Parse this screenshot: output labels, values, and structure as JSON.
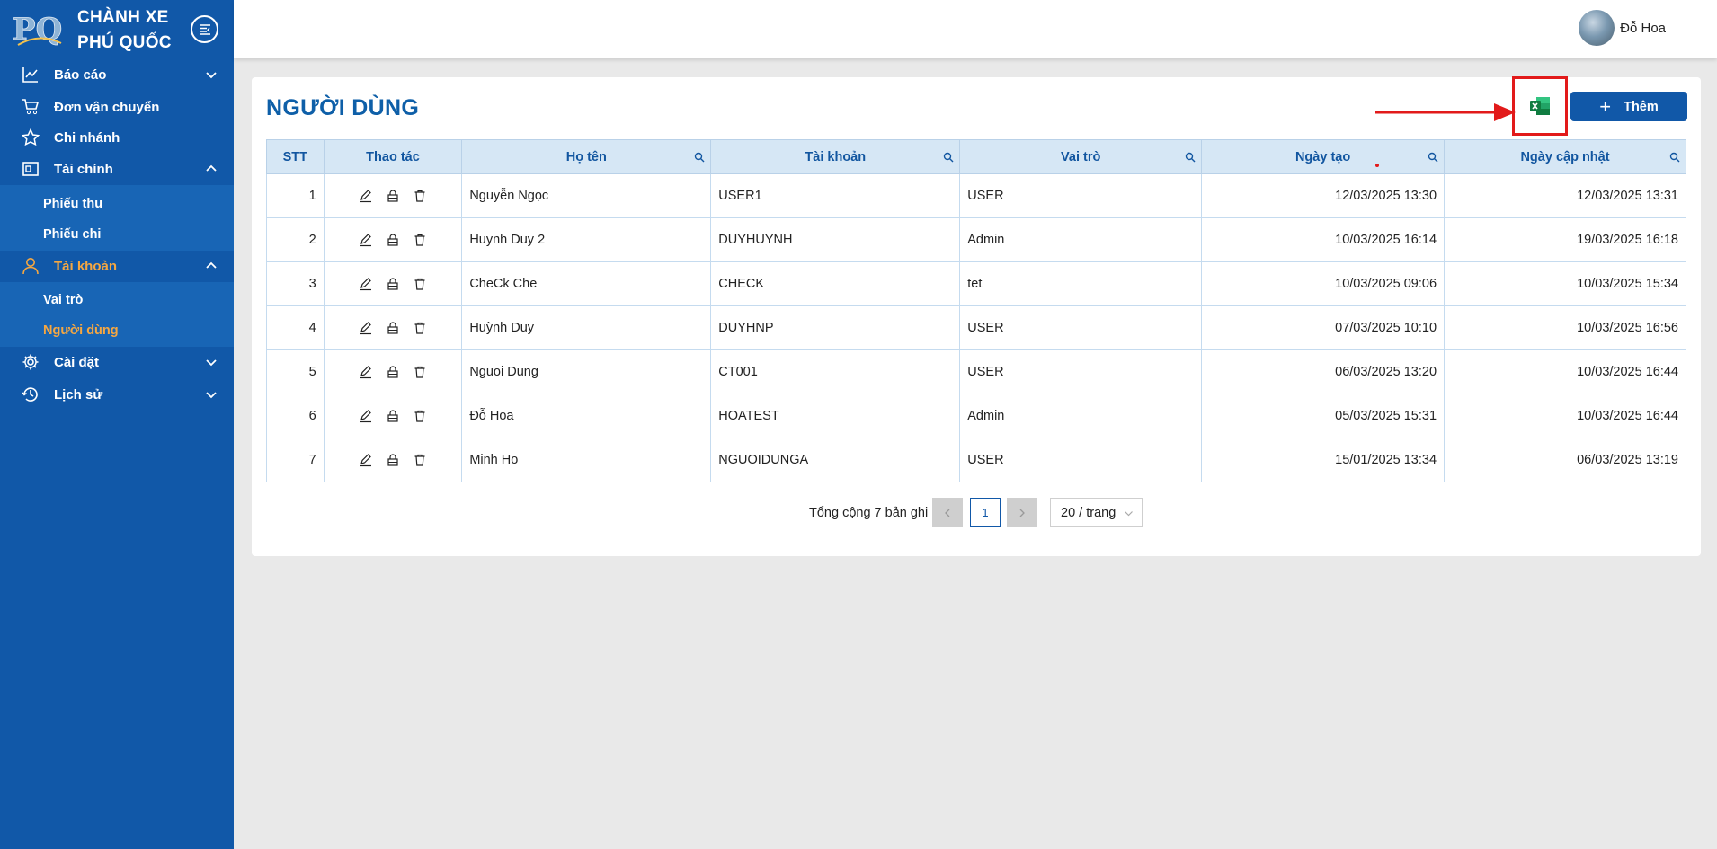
{
  "brand": {
    "logo_text": "PQ",
    "line1": "CHÀNH XE",
    "line2": "PHÚ QUỐC"
  },
  "sidebar": {
    "items": [
      {
        "label": "Báo cáo",
        "icon": "chart-line-icon",
        "chevron": "down"
      },
      {
        "label": "Đơn vận chuyển",
        "icon": "cart-icon"
      },
      {
        "label": "Chi nhánh",
        "icon": "star-icon"
      },
      {
        "label": "Tài chính",
        "icon": "wallet-icon",
        "chevron": "up"
      },
      {
        "label": "Tài khoản",
        "icon": "user-icon",
        "chevron": "up",
        "active": true
      },
      {
        "label": "Cài đặt",
        "icon": "gear-icon",
        "chevron": "down"
      },
      {
        "label": "Lịch sử",
        "icon": "history-icon",
        "chevron": "down"
      }
    ],
    "finance_sub": [
      "Phiếu thu",
      "Phiếu chi"
    ],
    "account_sub": [
      "Vai trò",
      "Người dùng"
    ]
  },
  "header": {
    "username": "Đỗ Hoa"
  },
  "page": {
    "title": "NGƯỜI DÙNG",
    "add_label": "Thêm",
    "excel_icon": "excel-icon"
  },
  "table": {
    "columns": [
      "STT",
      "Thao tác",
      "Họ tên",
      "Tài khoản",
      "Vai trò",
      "Ngày tạo",
      "Ngày cập nhật"
    ],
    "rows": [
      {
        "stt": "1",
        "name": "Nguyễn Ngọc",
        "account": "USER1",
        "role": "USER",
        "created": "12/03/2025 13:30",
        "updated": "12/03/2025 13:31"
      },
      {
        "stt": "2",
        "name": "Huynh Duy 2",
        "account": "DUYHUYNH",
        "role": "Admin",
        "created": "10/03/2025 16:14",
        "updated": "19/03/2025 16:18"
      },
      {
        "stt": "3",
        "name": "CheCk Che",
        "account": "CHECK",
        "role": "tet",
        "created": "10/03/2025 09:06",
        "updated": "10/03/2025 15:34"
      },
      {
        "stt": "4",
        "name": "Huỳnh Duy",
        "account": "DUYHNP",
        "role": "USER",
        "created": "07/03/2025 10:10",
        "updated": "10/03/2025 16:56"
      },
      {
        "stt": "5",
        "name": "Nguoi Dung",
        "account": "CT001",
        "role": "USER",
        "created": "06/03/2025 13:20",
        "updated": "10/03/2025 16:44"
      },
      {
        "stt": "6",
        "name": "Đỗ Hoa",
        "account": "HOATEST",
        "role": "Admin",
        "created": "05/03/2025 15:31",
        "updated": "10/03/2025 16:44"
      },
      {
        "stt": "7",
        "name": "Minh Ho",
        "account": "NGUOIDUNGA",
        "role": "USER",
        "created": "15/01/2025 13:34",
        "updated": "06/03/2025 13:19"
      }
    ]
  },
  "pagination": {
    "total_text": "Tổng cộng 7 bản ghi",
    "current_page": "1",
    "page_size": "20 / trang"
  },
  "colors": {
    "sidebar": "#1158a8",
    "accent": "#f5a742",
    "header_bg": "#d6e7f5",
    "highlight": "#e21a1a"
  }
}
